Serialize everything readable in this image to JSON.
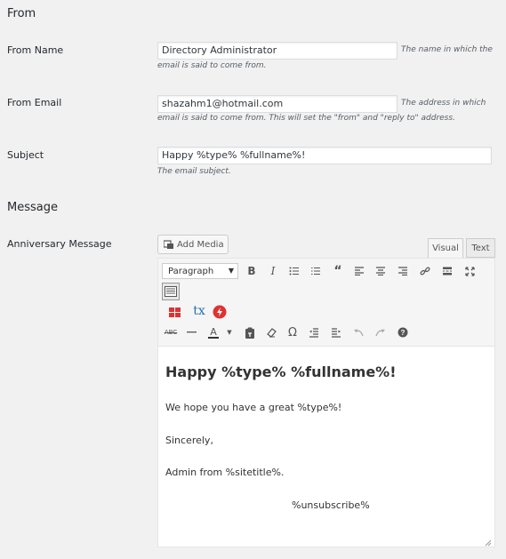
{
  "sections": {
    "from": "From",
    "message": "Message"
  },
  "from_name": {
    "label": "From Name",
    "value": "Directory Administrator",
    "desc_part1": "The name in which the",
    "desc_part2": "email is said to come from."
  },
  "from_email": {
    "label": "From Email",
    "value": "shazahm1@hotmail.com",
    "desc_part1": "The address in which",
    "desc_part2": "email is said to come from. This will set the \"from\" and \"reply to\" address."
  },
  "subject": {
    "label": "Subject",
    "value": "Happy %type% %fullname%!",
    "desc": "The email subject."
  },
  "anniversary": {
    "label": "Anniversary Message"
  },
  "editor": {
    "add_media": "Add Media",
    "tab_visual": "Visual",
    "tab_text": "Text",
    "format": "Paragraph",
    "heading": "Happy %type% %fullname%!",
    "p1": "We hope you have a great %type%!",
    "p2": "Sincerely,",
    "p3": "Admin from %sitetitle%.",
    "p4": "%unsubscribe%"
  },
  "icons": [
    "add-media-icon",
    "bold-icon",
    "italic-icon",
    "bullet-list-icon",
    "numbered-list-icon",
    "blockquote-icon",
    "align-left-icon",
    "align-center-icon",
    "align-right-icon",
    "link-icon",
    "read-more-icon",
    "fullscreen-icon",
    "toolbar-toggle-icon",
    "widget-icon",
    "tx-icon",
    "lightning-icon",
    "strikethrough-icon",
    "horizontal-line-icon",
    "text-color-icon",
    "paste-text-icon",
    "clear-formatting-icon",
    "omega-icon",
    "outdent-icon",
    "indent-icon",
    "undo-icon",
    "redo-icon",
    "help-icon",
    "resize-handle-icon"
  ],
  "colors": {
    "background": "#f1f1f1",
    "toolbar_bg": "#f5f5f5",
    "active_tab": "#f5f5f5",
    "red_accent": "#dd3333",
    "blue_accent": "#2271b1"
  }
}
